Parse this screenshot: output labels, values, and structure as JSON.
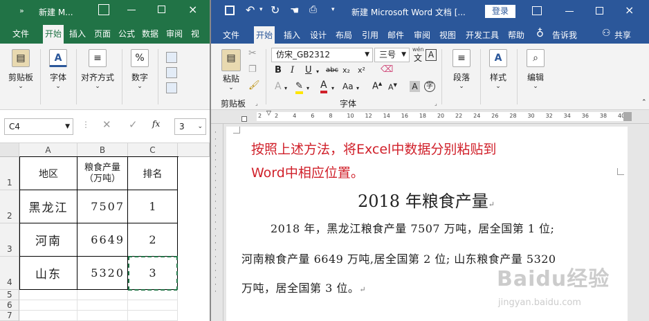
{
  "excel": {
    "title": "新建 M...",
    "tabs": [
      "文件",
      "开始",
      "插入",
      "页面",
      "公式",
      "数据",
      "审阅",
      "视"
    ],
    "active_tab": "开始",
    "ribbon": {
      "clipboard": "剪贴板",
      "font": "字体",
      "alignment": "对齐方式",
      "number": "数字",
      "number_symbol": "%",
      "font_symbol": "A"
    },
    "name_box": "C4",
    "formula_value": "3",
    "fx": "fx",
    "columns": [
      "A",
      "B",
      "C"
    ],
    "rows": [
      "1",
      "2",
      "3",
      "4",
      "5",
      "6",
      "7"
    ],
    "table": {
      "headers": [
        "地区",
        "粮食产量\n（万吨）",
        "排名"
      ],
      "header_line1": "粮食产量",
      "header_line2": "（万吨）",
      "data": [
        [
          "黑龙江",
          "7507",
          "1"
        ],
        [
          "河南",
          "6649",
          "2"
        ],
        [
          "山东",
          "5320",
          "3"
        ]
      ]
    }
  },
  "word": {
    "title": "新建 Microsoft Word 文档 [...",
    "login": "登录",
    "tabs": [
      "文件",
      "开始",
      "插入",
      "设计",
      "布局",
      "引用",
      "邮件",
      "审阅",
      "视图",
      "开发工具",
      "帮助"
    ],
    "active_tab": "开始",
    "tell_me": "告诉我",
    "share": "共享",
    "ribbon": {
      "paste": "粘贴",
      "clipboard": "剪贴板",
      "font_name": "仿宋_GB2312",
      "font_size": "三号",
      "font_group": "字体",
      "paragraph": "段落",
      "styles": "样式",
      "editing": "编辑",
      "wen": "wén",
      "bold": "B",
      "italic": "I",
      "underline": "U",
      "strike": "abc",
      "sub": "x₂",
      "sup": "x²",
      "font_color_a": "A",
      "aa": "Aa",
      "wen_char": "文",
      "zi_char": "字"
    },
    "ruler_marks": [
      "2",
      "2",
      "4",
      "6",
      "8",
      "10",
      "12",
      "14",
      "16",
      "18",
      "20",
      "22",
      "24",
      "26",
      "28",
      "30",
      "32",
      "34",
      "36",
      "38",
      "40"
    ],
    "instruction_line1": "按照上述方法，将Excel中数据分别粘贴到",
    "instruction_line2": "Word中相应位置。",
    "doc_title": "2018 年粮食产量",
    "body_line1": "2018 年，黑龙江粮食产量 7507 万吨，居全国第 1 位;",
    "body_line2": "河南粮食产量 6649 万吨,居全国第 2 位; 山东粮食产量 5320",
    "body_line3": "万吨，居全国第 3 位。"
  },
  "watermark": {
    "brand": "Baidu经验",
    "url": "jingyan.baidu.com"
  },
  "colors": {
    "excel_green": "#217346",
    "word_blue": "#2b579a",
    "instruction_red": "#d0202a"
  }
}
